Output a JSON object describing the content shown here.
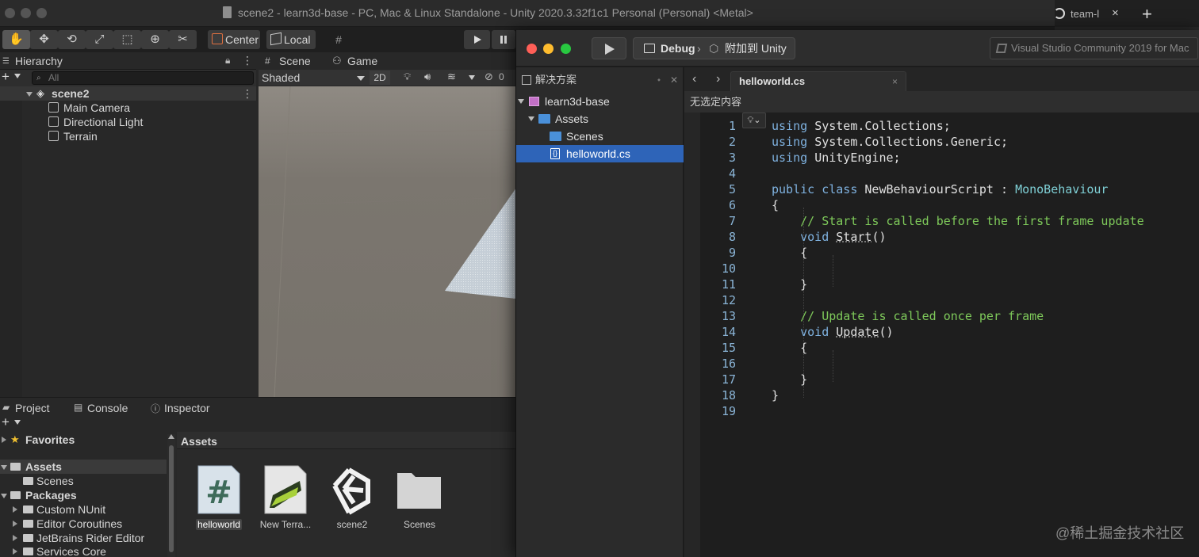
{
  "unity": {
    "window_title": "scene2 - learn3d-base - PC, Mac & Linux Standalone - Unity 2020.3.32f1c1 Personal (Personal) <Metal>",
    "browser_tab": {
      "title": "team-l",
      "close": "×",
      "new": "+"
    },
    "toolbar": {
      "center_label": "Center",
      "local_label": "Local"
    },
    "hierarchy": {
      "tab_label": "Hierarchy",
      "search_placeholder": "All",
      "scene_name": "scene2",
      "items": [
        "Main Camera",
        "Directional Light",
        "Terrain"
      ]
    },
    "scene": {
      "tabs": [
        "Scene",
        "Game"
      ],
      "shading_mode": "Shaded",
      "mode_2d": "2D",
      "hidden_count": "0"
    },
    "project": {
      "tabs": [
        "Project",
        "Console",
        "Inspector"
      ],
      "tree": [
        {
          "label": "Favorites",
          "bold": true
        },
        {
          "label": "Assets",
          "bold": true
        },
        {
          "label": "Scenes",
          "bold": false
        },
        {
          "label": "Packages",
          "bold": true
        },
        {
          "label": "Custom NUnit",
          "bold": false
        },
        {
          "label": "Editor Coroutines",
          "bold": false
        },
        {
          "label": "JetBrains Rider Editor",
          "bold": false
        },
        {
          "label": "Services Core",
          "bold": false
        }
      ],
      "assets_header": "Assets",
      "assets": [
        "helloworld",
        "New Terra...",
        "scene2",
        "Scenes"
      ]
    }
  },
  "vs": {
    "config_label": "Debug",
    "target_label": "附加到 Unity",
    "app_name": "Visual Studio Community 2019 for Mac",
    "solution_header": "解决方案",
    "solution_tree": [
      "learn3d-base",
      "Assets",
      "Scenes",
      "helloworld.cs"
    ],
    "file_tab": "helloworld.cs",
    "file_close": "×",
    "breadcrumb": "无选定内容",
    "code_lines": [
      "using System.Collections;",
      "using System.Collections.Generic;",
      "using UnityEngine;",
      "",
      "public class NewBehaviourScript : MonoBehaviour",
      "{",
      "    // Start is called before the first frame update",
      "    void Start()",
      "    {",
      "",
      "    }",
      "",
      "    // Update is called once per frame",
      "    void Update()",
      "    {",
      "",
      "    }",
      "}",
      ""
    ],
    "line_numbers": [
      "1",
      "2",
      "3",
      "4",
      "5",
      "6",
      "7",
      "8",
      "9",
      "10",
      "11",
      "12",
      "13",
      "14",
      "15",
      "16",
      "17",
      "18",
      "19"
    ]
  },
  "watermark": "@稀土掘金技术社区",
  "colors": {
    "selection": "#2e64b8",
    "keyword": "#7fb2e0",
    "type": "#7fd0d6",
    "comment": "#7ec95a",
    "line_number": "#8ab4d6"
  }
}
